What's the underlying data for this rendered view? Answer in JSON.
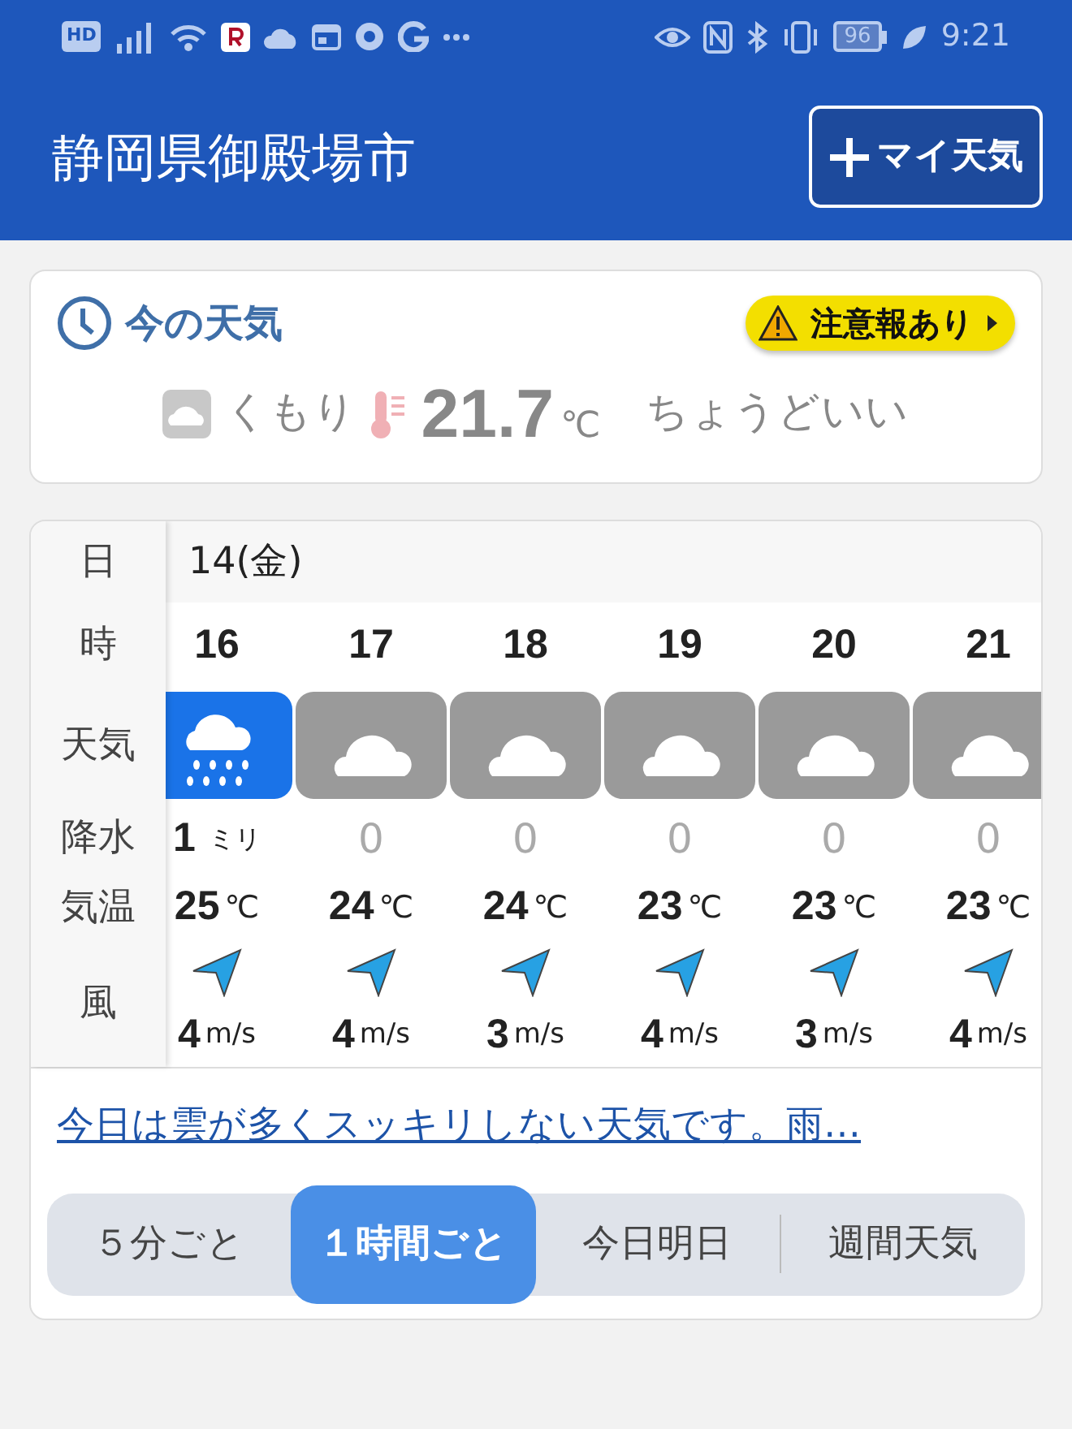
{
  "status_bar": {
    "network_badge": "HD",
    "battery": "96",
    "time": "9:21"
  },
  "header": {
    "title": "静岡県御殿場市",
    "button": "マイ天気"
  },
  "current": {
    "title": "今の天気",
    "alert": "注意報あり",
    "condition": "くもり",
    "temperature": "21.7",
    "unit": "℃",
    "feeling": "ちょうどいい"
  },
  "hourly": {
    "row_labels": [
      "日",
      "時",
      "天気",
      "降水",
      "気温",
      "風"
    ],
    "date": "14(金)",
    "hours": [
      {
        "hour": "16",
        "kind": "rain",
        "precip": "1",
        "precip_unit": "ミリ",
        "temp": "25",
        "temp_unit": "℃",
        "wind": "4",
        "wind_unit": "m/s"
      },
      {
        "hour": "17",
        "kind": "cloudy",
        "precip": "0",
        "temp": "24",
        "temp_unit": "℃",
        "wind": "4",
        "wind_unit": "m/s"
      },
      {
        "hour": "18",
        "kind": "cloudy",
        "precip": "0",
        "temp": "24",
        "temp_unit": "℃",
        "wind": "3",
        "wind_unit": "m/s"
      },
      {
        "hour": "19",
        "kind": "cloudy",
        "precip": "0",
        "temp": "23",
        "temp_unit": "℃",
        "wind": "4",
        "wind_unit": "m/s"
      },
      {
        "hour": "20",
        "kind": "cloudy",
        "precip": "0",
        "temp": "23",
        "temp_unit": "℃",
        "wind": "3",
        "wind_unit": "m/s"
      },
      {
        "hour": "21",
        "kind": "cloudy",
        "precip": "0",
        "temp": "23",
        "temp_unit": "℃",
        "wind": "4",
        "wind_unit": "m/s"
      }
    ]
  },
  "summary": "今日は雲が多くスッキリしない天気です。雨…",
  "tabs": [
    {
      "label": "５分ごと",
      "selected": false
    },
    {
      "label": "１時間ごと",
      "selected": true
    },
    {
      "label": "今日明日",
      "selected": false
    },
    {
      "label": "週間天気",
      "selected": false
    }
  ]
}
